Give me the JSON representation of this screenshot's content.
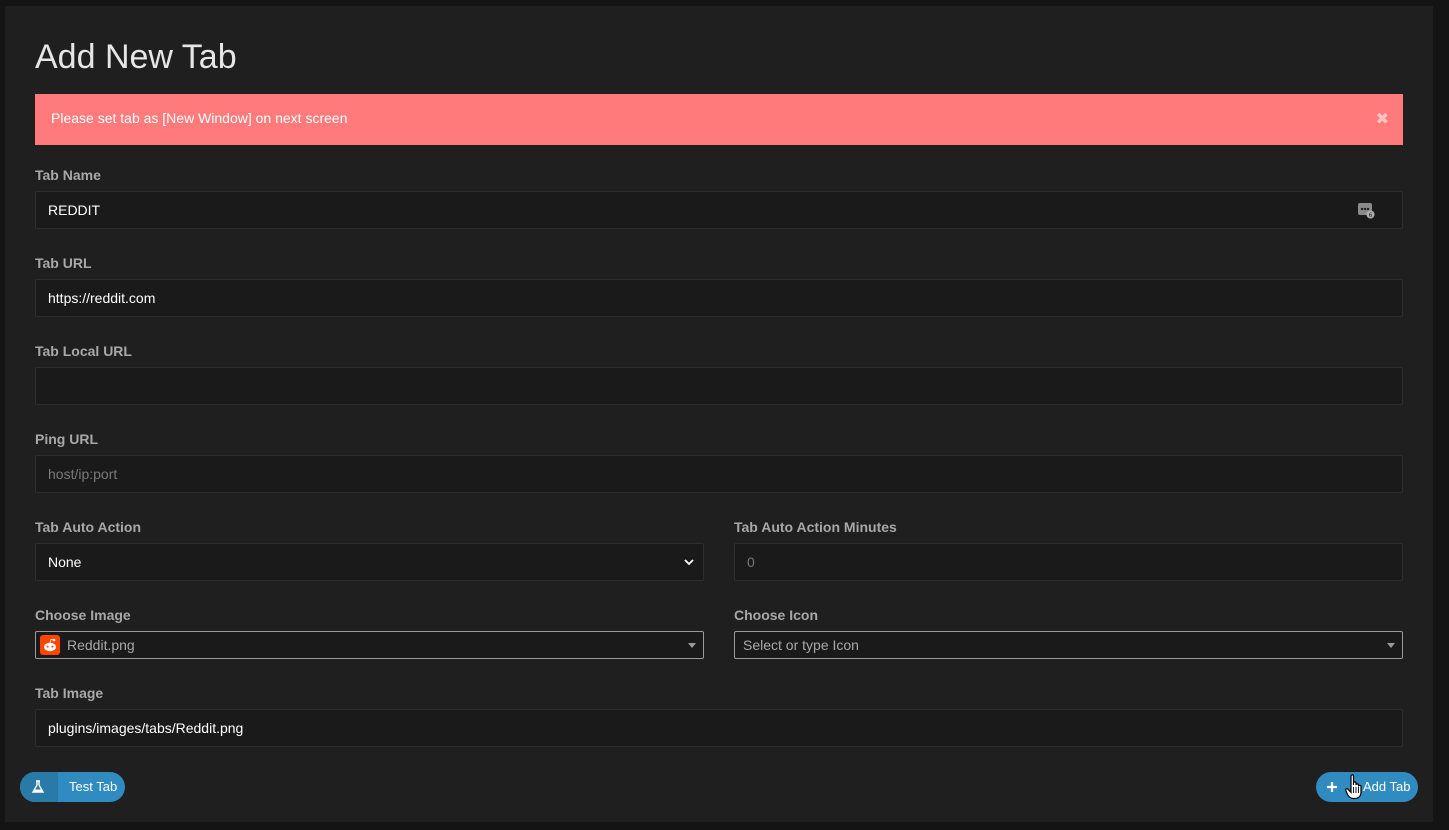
{
  "modal": {
    "title": "Add New Tab",
    "alert": {
      "message": "Please set tab as [New Window] on next screen",
      "close_glyph": "✖"
    }
  },
  "form": {
    "tab_name": {
      "label": "Tab Name",
      "value": "REDDIT",
      "icon": "password-manager-icon"
    },
    "tab_url": {
      "label": "Tab URL",
      "value": "https://reddit.com"
    },
    "tab_local_url": {
      "label": "Tab Local URL",
      "value": ""
    },
    "ping_url": {
      "label": "Ping URL",
      "value": "",
      "placeholder": "host/ip:port"
    },
    "tab_auto_action": {
      "label": "Tab Auto Action",
      "selected": "None"
    },
    "tab_auto_action_minutes": {
      "label": "Tab Auto Action Minutes",
      "value": "",
      "placeholder": "0"
    },
    "choose_image": {
      "label": "Choose Image",
      "selected": "Reddit.png",
      "icon": "reddit-icon"
    },
    "choose_icon": {
      "label": "Choose Icon",
      "selected": "",
      "placeholder": "Select or type Icon"
    },
    "tab_image": {
      "label": "Tab Image",
      "value": "plugins/images/tabs/Reddit.png"
    }
  },
  "buttons": {
    "test_tab": {
      "label": "Test Tab",
      "icon": "flask-icon"
    },
    "add_tab": {
      "label": "Add Tab",
      "icon": "plus-icon"
    }
  },
  "colors": {
    "alert_bg": "#ff7a7a",
    "button_bg": "#2f8bc0",
    "modal_bg": "#1f1f1f",
    "brand_reddit": "#ff4500"
  }
}
